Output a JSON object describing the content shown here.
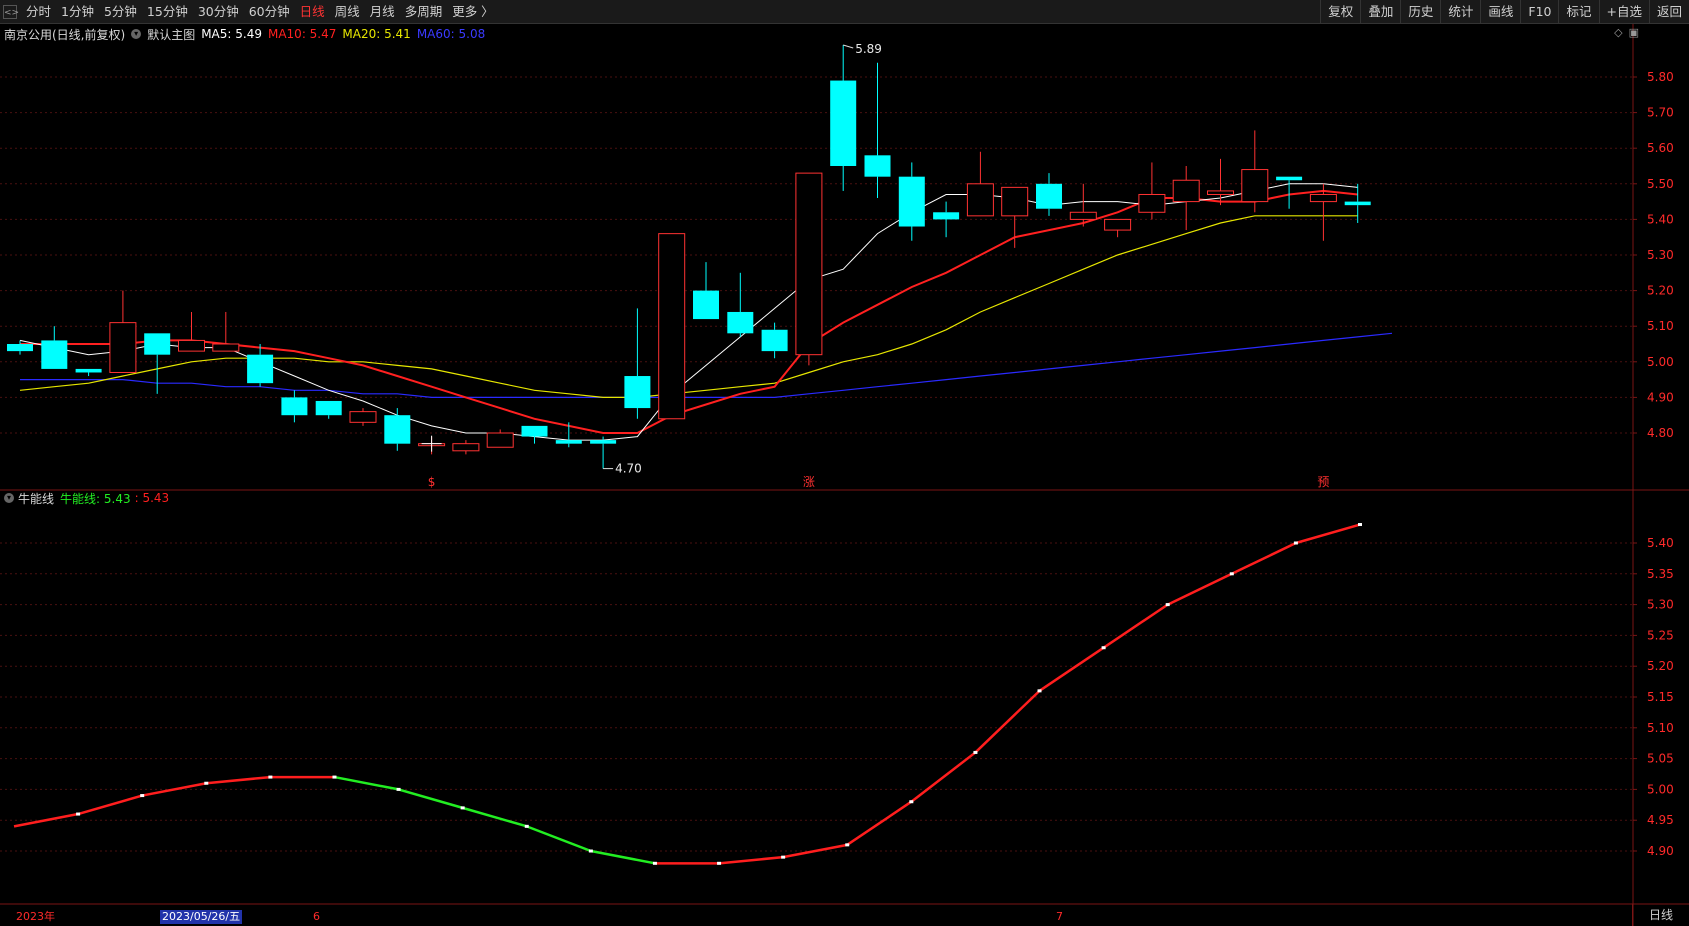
{
  "toolbar": {
    "periods": [
      "分时",
      "1分钟",
      "5分钟",
      "15分钟",
      "30分钟",
      "60分钟",
      "日线",
      "周线",
      "月线",
      "多周期",
      "更多 〉"
    ],
    "active_index": 6,
    "right_buttons": [
      "复权",
      "叠加",
      "历史",
      "统计",
      "画线",
      "F10",
      "标记",
      "+自选",
      "返回"
    ]
  },
  "main_panel": {
    "title": "南京公用(日线,前复权)",
    "template": "默认主图",
    "ma5": "MA5: 5.49",
    "ma10": "MA10: 5.47",
    "ma20": "MA20: 5.41",
    "ma60": "MA60: 5.08",
    "high_label": "5.89",
    "low_label": "4.70",
    "markers": [
      "$",
      "涨",
      "预"
    ],
    "y_ticks": [
      "5.80",
      "5.70",
      "5.60",
      "5.50",
      "5.40",
      "5.30",
      "5.20",
      "5.10",
      "5.00",
      "4.90",
      "4.80"
    ]
  },
  "sub_panel": {
    "name": "牛能线",
    "line_label": "牛能线: 5.43",
    "value_label": ": 5.43",
    "y_ticks": [
      "5.40",
      "5.35",
      "5.30",
      "5.25",
      "5.20",
      "5.15",
      "5.10",
      "5.05",
      "5.00",
      "4.95",
      "4.90"
    ]
  },
  "x_axis": {
    "year_label": "2023年",
    "cursor_date": "2023/05/26/五",
    "month_6": "6",
    "month_7": "7",
    "period_label": "日线"
  },
  "colors": {
    "up": "#ff3232",
    "down": "#00ffff",
    "ma5": "#ffffff",
    "ma10": "#ff2020",
    "ma20": "#e6e600",
    "ma60": "#2a2aff",
    "sub_up": "#ff1e1e",
    "sub_down": "#22ee22",
    "axis": "#7a1515",
    "grid": "#4a1010"
  },
  "chart_data": {
    "type": "candlestick",
    "candles": [
      {
        "o": 5.05,
        "c": 5.03,
        "h": 5.06,
        "l": 5.02
      },
      {
        "o": 5.06,
        "c": 4.98,
        "h": 5.1,
        "l": 4.98
      },
      {
        "o": 4.98,
        "c": 4.97,
        "h": 4.98,
        "l": 4.96
      },
      {
        "o": 4.97,
        "c": 5.11,
        "h": 5.2,
        "l": 4.97
      },
      {
        "o": 5.08,
        "c": 5.02,
        "h": 5.08,
        "l": 4.91
      },
      {
        "o": 5.03,
        "c": 5.06,
        "h": 5.14,
        "l": 5.03
      },
      {
        "o": 5.03,
        "c": 5.05,
        "h": 5.14,
        "l": 5.03
      },
      {
        "o": 5.02,
        "c": 4.94,
        "h": 5.05,
        "l": 4.93
      },
      {
        "o": 4.9,
        "c": 4.85,
        "h": 4.92,
        "l": 4.83
      },
      {
        "o": 4.89,
        "c": 4.85,
        "h": 4.89,
        "l": 4.84
      },
      {
        "o": 4.83,
        "c": 4.86,
        "h": 4.87,
        "l": 4.82
      },
      {
        "o": 4.85,
        "c": 4.77,
        "h": 4.87,
        "l": 4.75
      },
      {
        "o": 4.77,
        "c": 4.77,
        "h": 4.79,
        "l": 4.74
      },
      {
        "o": 4.75,
        "c": 4.77,
        "h": 4.78,
        "l": 4.74
      },
      {
        "o": 4.76,
        "c": 4.8,
        "h": 4.81,
        "l": 4.76
      },
      {
        "o": 4.82,
        "c": 4.79,
        "h": 4.82,
        "l": 4.77
      },
      {
        "o": 4.78,
        "c": 4.77,
        "h": 4.83,
        "l": 4.76
      },
      {
        "o": 4.78,
        "c": 4.77,
        "h": 4.79,
        "l": 4.7
      },
      {
        "o": 4.96,
        "c": 4.87,
        "h": 5.15,
        "l": 4.84
      },
      {
        "o": 4.84,
        "c": 5.36,
        "h": 5.36,
        "l": 4.84
      },
      {
        "o": 5.2,
        "c": 5.12,
        "h": 5.28,
        "l": 5.12
      },
      {
        "o": 5.14,
        "c": 5.08,
        "h": 5.25,
        "l": 5.07
      },
      {
        "o": 5.09,
        "c": 5.03,
        "h": 5.11,
        "l": 5.01
      },
      {
        "o": 5.02,
        "c": 5.53,
        "h": 5.53,
        "l": 4.99
      },
      {
        "o": 5.79,
        "c": 5.55,
        "h": 5.89,
        "l": 5.48
      },
      {
        "o": 5.58,
        "c": 5.52,
        "h": 5.84,
        "l": 5.46
      },
      {
        "o": 5.52,
        "c": 5.38,
        "h": 5.56,
        "l": 5.34
      },
      {
        "o": 5.42,
        "c": 5.4,
        "h": 5.45,
        "l": 5.35
      },
      {
        "o": 5.41,
        "c": 5.5,
        "h": 5.59,
        "l": 5.41
      },
      {
        "o": 5.41,
        "c": 5.49,
        "h": 5.49,
        "l": 5.32
      },
      {
        "o": 5.5,
        "c": 5.43,
        "h": 5.53,
        "l": 5.41
      },
      {
        "o": 5.4,
        "c": 5.42,
        "h": 5.5,
        "l": 5.38
      },
      {
        "o": 5.37,
        "c": 5.4,
        "h": 5.4,
        "l": 5.35
      },
      {
        "o": 5.42,
        "c": 5.47,
        "h": 5.56,
        "l": 5.4
      },
      {
        "o": 5.45,
        "c": 5.51,
        "h": 5.55,
        "l": 5.37
      },
      {
        "o": 5.47,
        "c": 5.48,
        "h": 5.57,
        "l": 5.44
      },
      {
        "o": 5.45,
        "c": 5.54,
        "h": 5.65,
        "l": 5.42
      },
      {
        "o": 5.52,
        "c": 5.51,
        "h": 5.52,
        "l": 5.43
      },
      {
        "o": 5.45,
        "c": 5.47,
        "h": 5.5,
        "l": 5.34
      },
      {
        "o": 5.45,
        "c": 5.44,
        "h": 5.5,
        "l": 5.39
      }
    ],
    "ma5": [
      5.06,
      5.04,
      5.02,
      5.03,
      5.05,
      5.04,
      5.04,
      5.0,
      4.96,
      4.92,
      4.89,
      4.85,
      4.82,
      4.8,
      4.8,
      4.79,
      4.78,
      4.78,
      4.79,
      4.91,
      4.99,
      5.07,
      5.15,
      5.23,
      5.26,
      5.36,
      5.42,
      5.47,
      5.47,
      5.46,
      5.44,
      5.45,
      5.45,
      5.44,
      5.45,
      5.46,
      5.48,
      5.5,
      5.5,
      5.49
    ],
    "ma10": [
      5.05,
      5.05,
      5.05,
      5.05,
      5.06,
      5.06,
      5.05,
      5.04,
      5.03,
      5.01,
      4.99,
      4.96,
      4.93,
      4.9,
      4.87,
      4.84,
      4.82,
      4.8,
      4.8,
      4.85,
      4.88,
      4.91,
      4.93,
      5.05,
      5.11,
      5.16,
      5.21,
      5.25,
      5.3,
      5.35,
      5.37,
      5.39,
      5.42,
      5.46,
      5.46,
      5.45,
      5.45,
      5.47,
      5.48,
      5.47
    ],
    "ma20": [
      4.92,
      4.93,
      4.94,
      4.96,
      4.98,
      5.0,
      5.01,
      5.01,
      5.01,
      5.0,
      5.0,
      4.99,
      4.98,
      4.96,
      4.94,
      4.92,
      4.91,
      4.9,
      4.9,
      4.91,
      4.92,
      4.93,
      4.94,
      4.97,
      5.0,
      5.02,
      5.05,
      5.09,
      5.14,
      5.18,
      5.22,
      5.26,
      5.3,
      5.33,
      5.36,
      5.39,
      5.41,
      5.41,
      5.41,
      5.41
    ],
    "ma60": [
      4.95,
      4.95,
      4.95,
      4.95,
      4.94,
      4.94,
      4.93,
      4.93,
      4.92,
      4.92,
      4.91,
      4.91,
      4.9,
      4.9,
      4.9,
      4.9,
      4.9,
      4.9,
      4.9,
      4.9,
      4.9,
      4.9,
      4.9,
      4.91,
      4.92,
      4.93,
      4.94,
      4.95,
      4.96,
      4.97,
      4.98,
      4.99,
      5.0,
      5.01,
      5.02,
      5.03,
      5.04,
      5.05,
      5.06,
      5.07,
      5.08
    ],
    "bull_line": [
      4.94,
      4.96,
      4.99,
      5.01,
      5.02,
      5.02,
      5.0,
      4.97,
      4.94,
      4.9,
      4.88,
      4.88,
      4.89,
      4.91,
      4.98,
      5.06,
      5.16,
      5.23,
      5.3,
      5.35,
      5.4,
      5.43
    ]
  }
}
